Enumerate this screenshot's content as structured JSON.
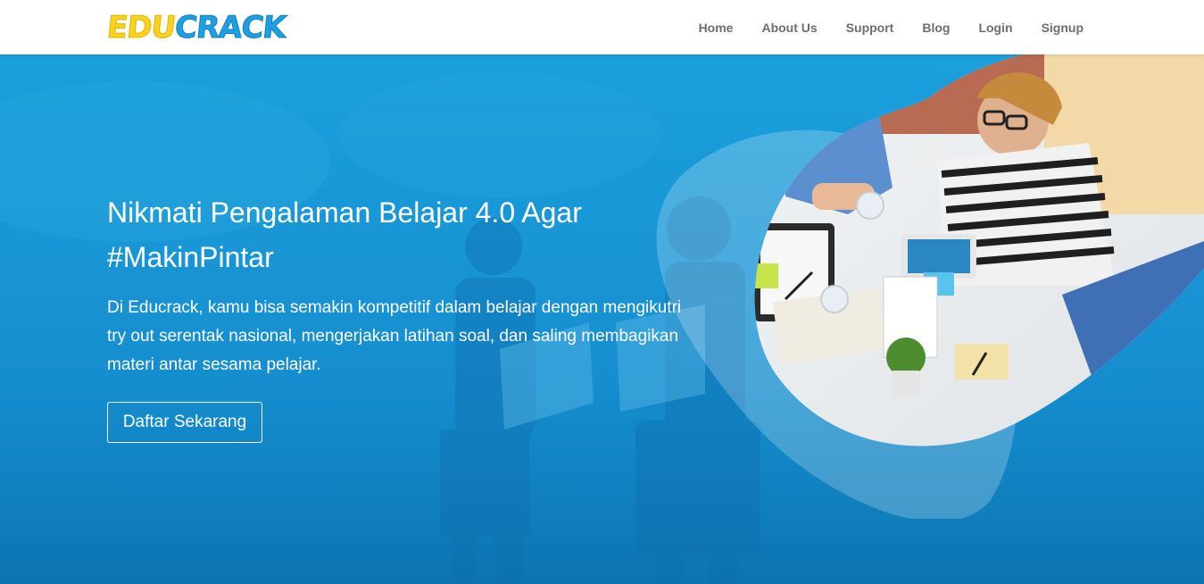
{
  "brand": {
    "logo_part1": "EDU",
    "logo_part2": "CRACK",
    "logo_colors": {
      "edu": "#f9d31b",
      "crack": "#1e9fe0"
    }
  },
  "nav": {
    "items": [
      {
        "label": "Home"
      },
      {
        "label": "About Us"
      },
      {
        "label": "Support"
      },
      {
        "label": "Blog"
      },
      {
        "label": "Login"
      },
      {
        "label": "Signup"
      }
    ]
  },
  "hero": {
    "title": "Nikmati Pengalaman Belajar 4.0 Agar #MakinPintar",
    "description": "Di Educrack, kamu bisa semakin kompetitif dalam belajar dengan mengikutri try out serentak nasional, mengerjakan latihan soal, dan saling membagikan materi antar sesama pelajar.",
    "cta_label": "Daftar Sekarang",
    "background_color": "#1893d4",
    "image": "students-meeting-table-photo"
  }
}
